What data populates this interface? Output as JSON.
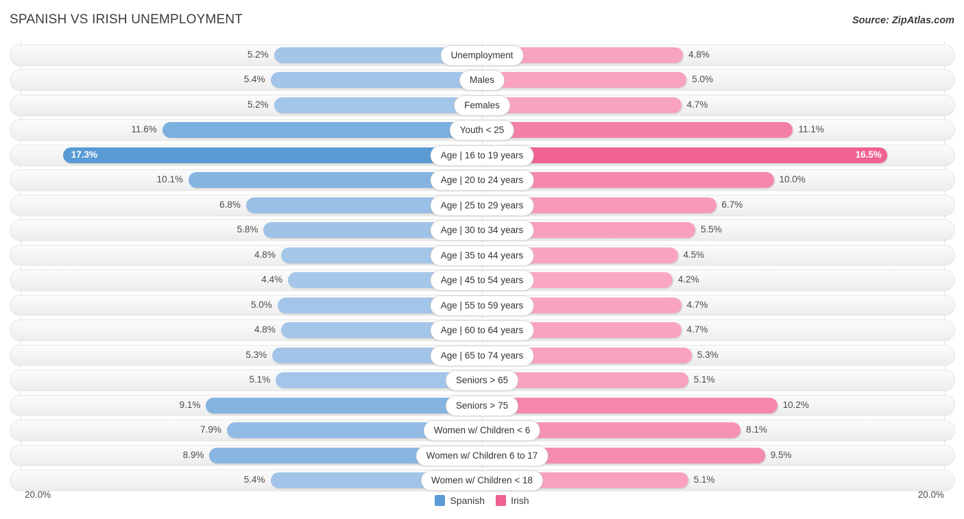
{
  "header": {
    "title": "SPANISH VS IRISH UNEMPLOYMENT",
    "source": "Source: ZipAtlas.com"
  },
  "axis": {
    "left_label": "20.0%",
    "right_label": "20.0%",
    "max": 20.0
  },
  "legend": {
    "items": [
      {
        "label": "Spanish",
        "color": "#5B9BD5"
      },
      {
        "label": "Irish",
        "color": "#F0628F"
      }
    ]
  },
  "colors": {
    "left_light": "#A8C8EA",
    "left_strong": "#5B9BD5",
    "right_light": "#F9A8C3",
    "right_strong": "#F0628F",
    "track": "#f4f4f4",
    "gridline": "#e3e3e3"
  },
  "chart_data": {
    "type": "bar",
    "subtype": "diverging-bar",
    "title": "SPANISH VS IRISH UNEMPLOYMENT",
    "xlabel": "",
    "ylabel": "",
    "xlim": [
      20.0,
      20.0
    ],
    "grid": true,
    "legend_position": "bottom-center",
    "units": "%",
    "categories": [
      "Unemployment",
      "Males",
      "Females",
      "Youth < 25",
      "Age | 16 to 19 years",
      "Age | 20 to 24 years",
      "Age | 25 to 29 years",
      "Age | 30 to 34 years",
      "Age | 35 to 44 years",
      "Age | 45 to 54 years",
      "Age | 55 to 59 years",
      "Age | 60 to 64 years",
      "Age | 65 to 74 years",
      "Seniors > 65",
      "Seniors > 75",
      "Women w/ Children < 6",
      "Women w/ Children 6 to 17",
      "Women w/ Children < 18"
    ],
    "series": [
      {
        "name": "Spanish",
        "side": "left",
        "color": "#5B9BD5",
        "values": [
          5.2,
          5.4,
          5.2,
          11.6,
          17.3,
          10.1,
          6.8,
          5.8,
          4.8,
          4.4,
          5.0,
          4.8,
          5.3,
          5.1,
          9.1,
          7.9,
          8.9,
          5.4
        ],
        "labels": [
          "5.2%",
          "5.4%",
          "5.2%",
          "11.6%",
          "17.3%",
          "10.1%",
          "6.8%",
          "5.8%",
          "4.8%",
          "4.4%",
          "5.0%",
          "4.8%",
          "5.3%",
          "5.1%",
          "9.1%",
          "7.9%",
          "8.9%",
          "5.4%"
        ]
      },
      {
        "name": "Irish",
        "side": "right",
        "color": "#F0628F",
        "values": [
          4.8,
          5.0,
          4.7,
          11.1,
          16.5,
          10.0,
          6.7,
          5.5,
          4.5,
          4.2,
          4.7,
          4.7,
          5.3,
          5.1,
          10.2,
          8.1,
          9.5,
          5.1
        ],
        "labels": [
          "4.8%",
          "5.0%",
          "4.7%",
          "11.1%",
          "16.5%",
          "10.0%",
          "6.7%",
          "5.5%",
          "4.5%",
          "4.2%",
          "4.7%",
          "4.7%",
          "5.3%",
          "5.1%",
          "10.2%",
          "8.1%",
          "9.5%",
          "5.1%"
        ]
      }
    ]
  }
}
